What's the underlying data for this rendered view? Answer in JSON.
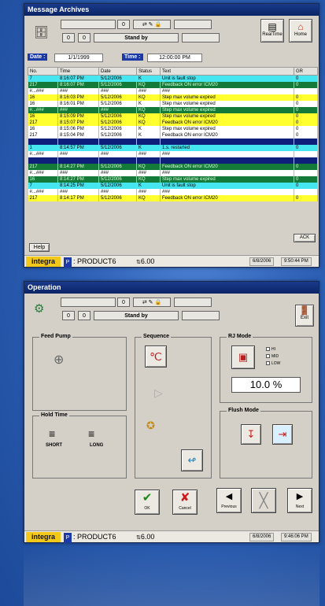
{
  "archives": {
    "title": "Message Archives",
    "counter_value": "0",
    "small_box_1": "0",
    "small_box_2": "0",
    "state": "Stand by",
    "realtime_label": "RealTime",
    "home_label": "Home",
    "date_label": "Date :",
    "date_value": "1/1/1999",
    "time_label": "Time :",
    "time_value": "12:00:00 PM",
    "columns": [
      "No.",
      "Time",
      "Date",
      "Status",
      "Text",
      "GR"
    ],
    "rows": [
      {
        "style": "cyan",
        "no": "7",
        "time": "8:16:07 PM",
        "date": "5/12/2006",
        "status": "K",
        "text": "Unit is fault stop",
        "gr": "0"
      },
      {
        "style": "green",
        "no": "217",
        "time": "8:16:07 PM",
        "date": "5/12/2006",
        "status": "KQ",
        "text": "Feedback ON error ICM20",
        "gr": "0"
      },
      {
        "style": "white",
        "no": "#...###",
        "time": "###",
        "date": "###",
        "status": "###",
        "text": "###",
        "gr": ""
      },
      {
        "style": "yellow",
        "no": "16",
        "time": "8:16:03 PM",
        "date": "5/12/2006",
        "status": "KQ",
        "text": "Step max volume expired",
        "gr": "0"
      },
      {
        "style": "white",
        "no": "16",
        "time": "8:16:01 PM",
        "date": "5/12/2006",
        "status": "K",
        "text": "Step max volume expired",
        "gr": "0"
      },
      {
        "style": "green",
        "no": "#...###",
        "time": "###",
        "date": "###",
        "status": "KQ",
        "text": "Step max volume expired",
        "gr": "0"
      },
      {
        "style": "yellow",
        "no": "16",
        "time": "8:15:09 PM",
        "date": "5/12/2006",
        "status": "KQ",
        "text": "Step max volume expired",
        "gr": "0"
      },
      {
        "style": "yellow",
        "no": "217",
        "time": "8:15:07 PM",
        "date": "5/12/2006",
        "status": "KQ",
        "text": "Feedback ON error ICM20",
        "gr": "0"
      },
      {
        "style": "white",
        "no": "16",
        "time": "8:15:06 PM",
        "date": "5/12/2006",
        "status": "K",
        "text": "Step max volume expired",
        "gr": "0"
      },
      {
        "style": "white",
        "no": "217",
        "time": "8:15:04 PM",
        "date": "5/12/2006",
        "status": "K",
        "text": "Feedback ON error ICM20",
        "gr": "0"
      },
      {
        "style": "navy",
        "no": "",
        "time": "",
        "date": "",
        "status": "",
        "text": "",
        "gr": ""
      },
      {
        "style": "cyan",
        "no": "1",
        "time": "8:14:57 PM",
        "date": "5/12/2006",
        "status": "K",
        "text": "1.s. restarted",
        "gr": "0"
      },
      {
        "style": "white",
        "no": "#...###",
        "time": "###",
        "date": "###",
        "status": "###",
        "text": "###",
        "gr": ""
      },
      {
        "style": "navy",
        "no": "",
        "time": "",
        "date": "",
        "status": "",
        "text": "",
        "gr": ""
      },
      {
        "style": "green",
        "no": "217",
        "time": "8:14:27 PM",
        "date": "5/12/2006",
        "status": "KQ",
        "text": "Feedback ON error ICM20",
        "gr": "0"
      },
      {
        "style": "white",
        "no": "#...###",
        "time": "###",
        "date": "###",
        "status": "###",
        "text": "###",
        "gr": ""
      },
      {
        "style": "green",
        "no": "16",
        "time": "8:14:27 PM",
        "date": "5/12/2006",
        "status": "KQ",
        "text": "Step max volume expired",
        "gr": "0"
      },
      {
        "style": "cyan",
        "no": "7",
        "time": "8:14:25 PM",
        "date": "5/12/2006",
        "status": "K",
        "text": "Unit is fault stop",
        "gr": "0"
      },
      {
        "style": "white",
        "no": "#...###",
        "time": "###",
        "date": "###",
        "status": "###",
        "text": "###",
        "gr": ""
      },
      {
        "style": "yellow",
        "no": "217",
        "time": "8:14:17 PM",
        "date": "5/12/2006",
        "status": "KQ",
        "text": "Feedback ON error ICM20",
        "gr": "0"
      }
    ],
    "help_label": "Help",
    "ack_label": "ACK",
    "date_status": "6/8/2006",
    "time_status": "9:50:44 PM"
  },
  "operation": {
    "title": "Operation",
    "counter_value": "0",
    "small_box_1": "0",
    "small_box_2": "0",
    "state": "Stand by",
    "exit_label": "Exit",
    "feed_pump_label": "Feed Pump",
    "hold_time_label": "Hold Time",
    "short_label": "SHORT",
    "long_label": "LONG",
    "sequence_label": "Sequence",
    "rj_mode_label": "RJ Mode",
    "hi_label": "HI",
    "mid_label": "MID",
    "low_label": "LOW",
    "rj_value": "10.0",
    "rj_unit": "%",
    "flush_mode_label": "Flush Mode",
    "ok_label": "OK",
    "cancel_label": "Cancel",
    "previous_label": "Previous",
    "next_label": "Next",
    "date_status": "6/8/2006",
    "time_status": "9:46:06 PM"
  },
  "status": {
    "brand": "integra",
    "product_badge": "P",
    "product": ": PRODUCT6",
    "version": "6.00"
  },
  "colors": {
    "accent": "#1b3aa8",
    "title_bar": "#0b2466",
    "brand_yellow": "#f2c81a"
  }
}
